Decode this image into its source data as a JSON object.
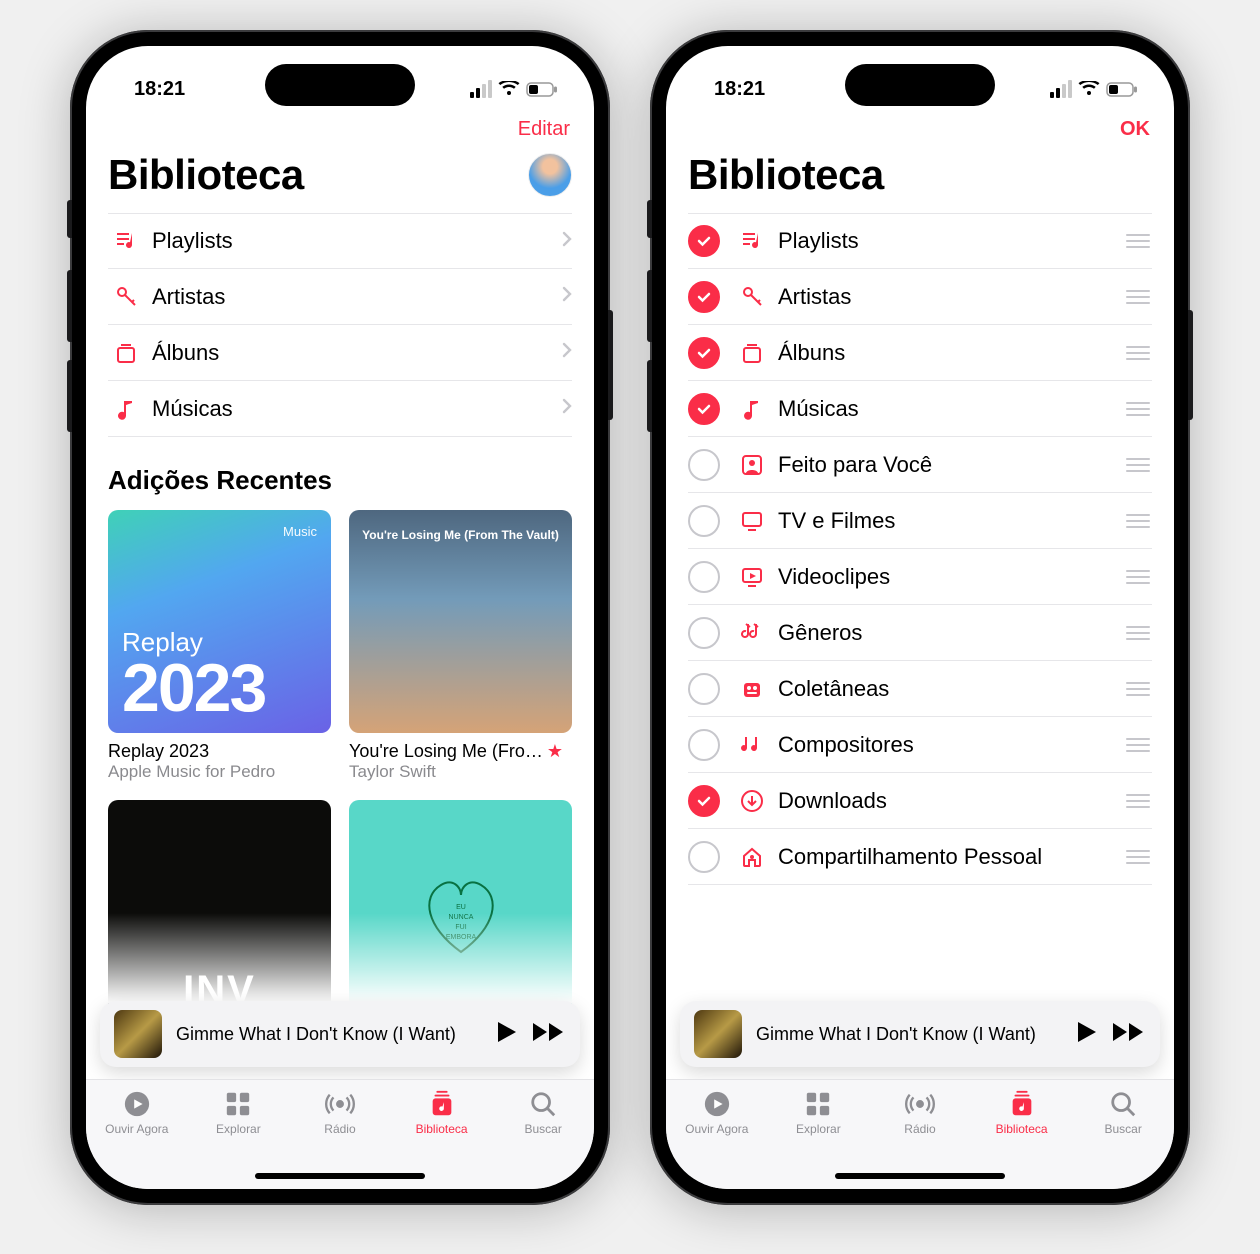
{
  "status": {
    "time": "18:21"
  },
  "left": {
    "edit": "Editar",
    "title": "Biblioteca",
    "items": [
      {
        "key": "playlists",
        "label": "Playlists"
      },
      {
        "key": "artistas",
        "label": "Artistas"
      },
      {
        "key": "albuns",
        "label": "Álbuns"
      },
      {
        "key": "musicas",
        "label": "Músicas"
      }
    ],
    "recent_header": "Adições Recentes",
    "recent": [
      {
        "title": "Replay 2023",
        "subtitle": "Apple Music for Pedro",
        "art": "replay",
        "badge": "Music",
        "rp": "Replay",
        "year": "2023"
      },
      {
        "title": "You're Losing Me (Fro…",
        "subtitle": "Taylor Swift",
        "art": "ts",
        "star": true,
        "cap": "You're Losing Me (From The Vault)"
      },
      {
        "title": "",
        "subtitle": "",
        "art": "inv",
        "cap": "INV"
      },
      {
        "title": "",
        "subtitle": "",
        "art": "teal",
        "cap": "EU NUNCA FUI EMBORA"
      }
    ]
  },
  "right": {
    "ok": "OK",
    "title": "Biblioteca",
    "items": [
      {
        "key": "playlists",
        "label": "Playlists",
        "on": true
      },
      {
        "key": "artistas",
        "label": "Artistas",
        "on": true
      },
      {
        "key": "albuns",
        "label": "Álbuns",
        "on": true
      },
      {
        "key": "musicas",
        "label": "Músicas",
        "on": true
      },
      {
        "key": "feito",
        "label": "Feito para Você",
        "on": false
      },
      {
        "key": "tv",
        "label": "TV e Filmes",
        "on": false
      },
      {
        "key": "clips",
        "label": "Videoclipes",
        "on": false
      },
      {
        "key": "generos",
        "label": "Gêneros",
        "on": false
      },
      {
        "key": "colet",
        "label": "Coletâneas",
        "on": false
      },
      {
        "key": "compos",
        "label": "Compositores",
        "on": false
      },
      {
        "key": "downloads",
        "label": "Downloads",
        "on": true
      },
      {
        "key": "share",
        "label": "Compartilhamento Pessoal",
        "on": false
      }
    ]
  },
  "player": {
    "title": "Gimme What I Don't Know (I Want)"
  },
  "tabs": [
    {
      "key": "ouvir",
      "label": "Ouvir Agora"
    },
    {
      "key": "explorar",
      "label": "Explorar"
    },
    {
      "key": "radio",
      "label": "Rádio"
    },
    {
      "key": "biblioteca",
      "label": "Biblioteca",
      "active": true
    },
    {
      "key": "buscar",
      "label": "Buscar"
    }
  ]
}
